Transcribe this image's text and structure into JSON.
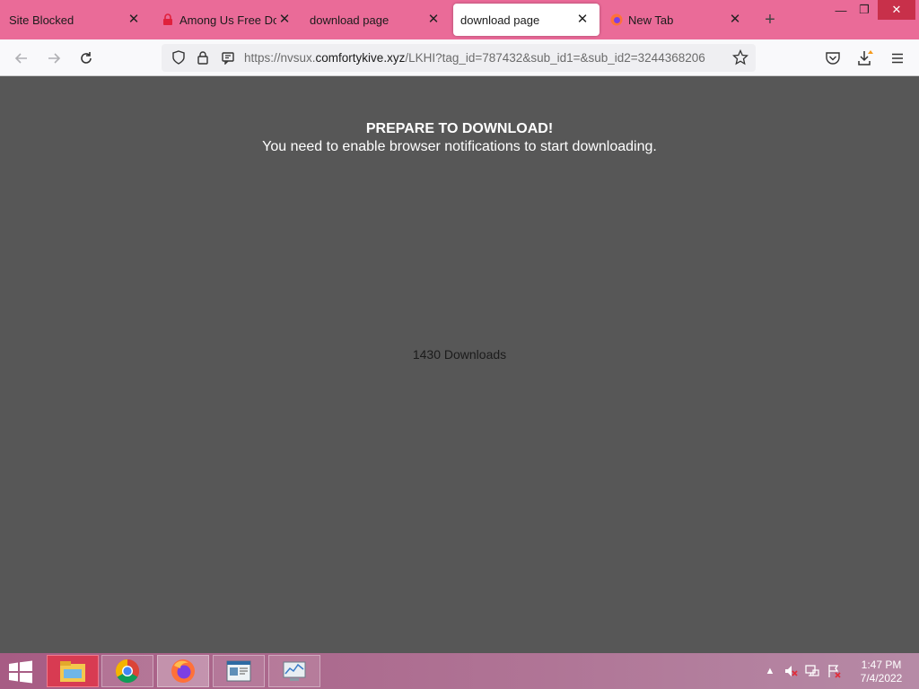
{
  "tabs": [
    {
      "label": "Site Blocked",
      "active": false
    },
    {
      "label": "Among Us Free Dow",
      "active": false
    },
    {
      "label": "download page",
      "active": false
    },
    {
      "label": "download page",
      "active": true
    },
    {
      "label": "New Tab",
      "active": false
    }
  ],
  "window_controls": {
    "minimize": "—",
    "restore": "❐",
    "close": "✕"
  },
  "url": {
    "scheme": "https://nvsux.",
    "host": "comfortykive.xyz",
    "path": "/LKHI?tag_id=787432&sub_id1=&sub_id2=3244368206"
  },
  "page": {
    "headline": "PREPARE TO DOWNLOAD!",
    "subline": "You need to enable browser notifications to start downloading.",
    "downloads": "1430 Downloads"
  },
  "clock": {
    "time": "1:47 PM",
    "date": "7/4/2022"
  },
  "colors": {
    "tabstrip": "#ea6b98",
    "content_bg": "#575757",
    "taskbar": "#a75c84"
  }
}
